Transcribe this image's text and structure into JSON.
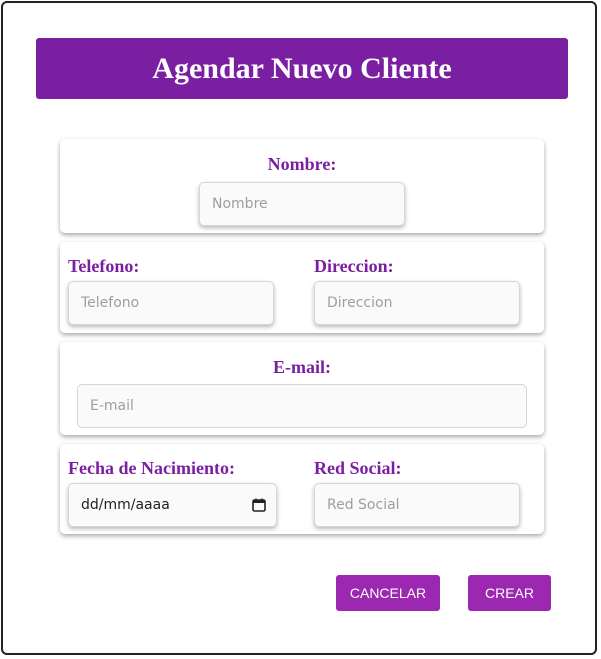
{
  "header": {
    "title": "Agendar Nuevo Cliente"
  },
  "form": {
    "nombre": {
      "label": "Nombre:",
      "placeholder": "Nombre"
    },
    "telefono": {
      "label": "Telefono:",
      "placeholder": "Telefono"
    },
    "direccion": {
      "label": "Direccion:",
      "placeholder": "Direccion"
    },
    "email": {
      "label": "E-mail:",
      "placeholder": "E-mail"
    },
    "fecha": {
      "label": "Fecha de Nacimiento:",
      "value": "dd/mm/aaaa",
      "icon": "calendar-icon"
    },
    "red_social": {
      "label": "Red Social:",
      "placeholder": "Red Social"
    }
  },
  "actions": {
    "cancel_label": "CANCELAR",
    "create_label": "CREAR"
  },
  "colors": {
    "primary": "#7b1fa2",
    "button": "#9c27b0"
  }
}
